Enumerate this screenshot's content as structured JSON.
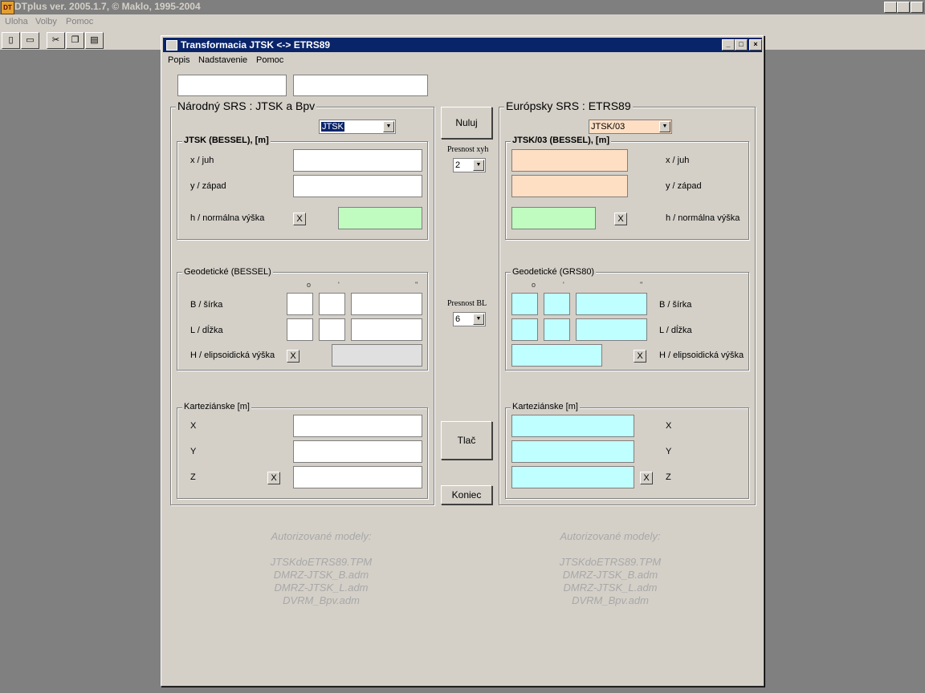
{
  "app": {
    "title": "DTplus ver. 2005.1.7, © Maklo, 1995-2004",
    "logo": "DT",
    "menu": [
      "Uloha",
      "Volby",
      "Pomoc"
    ],
    "caption_buttons": [
      "_",
      "❐",
      "×"
    ],
    "toolbar_icons": [
      "new-icon",
      "open-icon",
      "cut-icon",
      "copy-icon",
      "paste-icon"
    ]
  },
  "dialog": {
    "title": "Transformacia JTSK <-> ETRS89",
    "menu": [
      "Popis",
      "Nadstavenie",
      "Pomoc"
    ],
    "top_fields": [
      "",
      ""
    ],
    "left": {
      "title": "Národný SRS : JTSK a Bpv",
      "system_select": "JTSK",
      "jtsk_group": "JTSK (BESSEL), [m]",
      "x_label": "x / juh",
      "y_label": "y / západ",
      "h_label": "h / normálna výška",
      "geo_group": "Geodetické (BESSEL)",
      "b_label": "B / šírka",
      "l_label": "L / dĺžka",
      "H_label": "H / elipsoidická výška",
      "kart_group": "Karteziánske [m]",
      "X_label": "X",
      "Y_label": "Y",
      "Z_label": "Z"
    },
    "right": {
      "title": "Európsky SRS : ETRS89",
      "system_select": "JTSK/03",
      "jtsk_group": "JTSK/03 (BESSEL), [m]",
      "x_label": "x / juh",
      "y_label": "y / západ",
      "h_label": "h / normálna výška",
      "geo_group": "Geodetické (GRS80)",
      "b_label": "B / šírka",
      "l_label": "L / dĺžka",
      "H_label": "H / elipsoidická výška",
      "kart_group": "Karteziánske [m]",
      "X_label": "X",
      "Y_label": "Y",
      "Z_label": "Z"
    },
    "deg_marks": [
      "o",
      "'",
      "''"
    ],
    "center": {
      "nuluj": "Nuluj",
      "presnost_xyh": "Presnost xyh",
      "presnost_xyh_value": "2",
      "presnost_bl": "Presnost BL",
      "presnost_bl_value": "6",
      "tlac": "Tlač",
      "koniec": "Koniec"
    },
    "clear_label": "X",
    "models": {
      "heading": "Autorizované modely:",
      "items": [
        "JTSKdoETRS89.TPM",
        "DMRZ-JTSK_B.adm",
        "DMRZ-JTSK_L.adm",
        "DVRM_Bpv.adm"
      ]
    }
  }
}
